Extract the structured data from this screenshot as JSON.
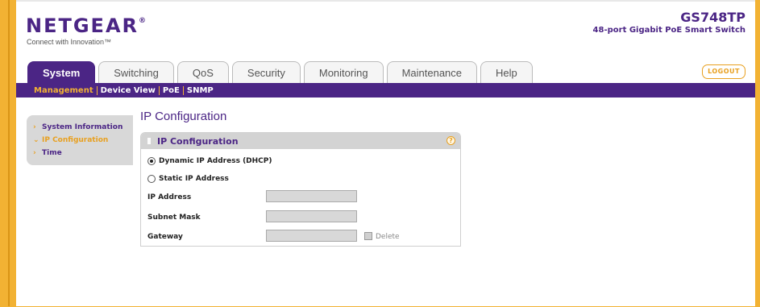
{
  "brand": {
    "logo": "NETGEAR",
    "logo_mark": "®",
    "tagline": "Connect with Innovation™",
    "model": "GS748TP",
    "model_desc": "48-port Gigabit PoE Smart Switch",
    "colors": {
      "primary": "#4b2585",
      "accent": "#e8a020",
      "frame": "#f2b233"
    }
  },
  "tabs": [
    {
      "label": "System",
      "active": true
    },
    {
      "label": "Switching"
    },
    {
      "label": "QoS"
    },
    {
      "label": "Security"
    },
    {
      "label": "Monitoring"
    },
    {
      "label": "Maintenance"
    },
    {
      "label": "Help"
    }
  ],
  "logout_label": "LOGOUT",
  "subnav": [
    {
      "label": "Management",
      "active": true
    },
    {
      "label": "Device View"
    },
    {
      "label": "PoE"
    },
    {
      "label": "SNMP"
    }
  ],
  "sidebar": [
    {
      "label": "System Information",
      "icon": "chevron-right-icon"
    },
    {
      "label": "IP Configuration",
      "icon": "chevron-down-icon",
      "active": true
    },
    {
      "label": "Time",
      "icon": "chevron-right-icon"
    }
  ],
  "page": {
    "title": "IP Configuration",
    "panel_title": "IP Configuration",
    "dhcp_label": "Dynamic IP Address (DHCP)",
    "dhcp_selected": true,
    "static_label": "Static IP Address",
    "static_selected": false,
    "ip_label": "IP Address",
    "ip_value": "",
    "subnet_label": "Subnet Mask",
    "subnet_value": "",
    "gateway_label": "Gateway",
    "gateway_value": "",
    "delete_label": "Delete",
    "delete_checked": false,
    "help_glyph": "?"
  }
}
